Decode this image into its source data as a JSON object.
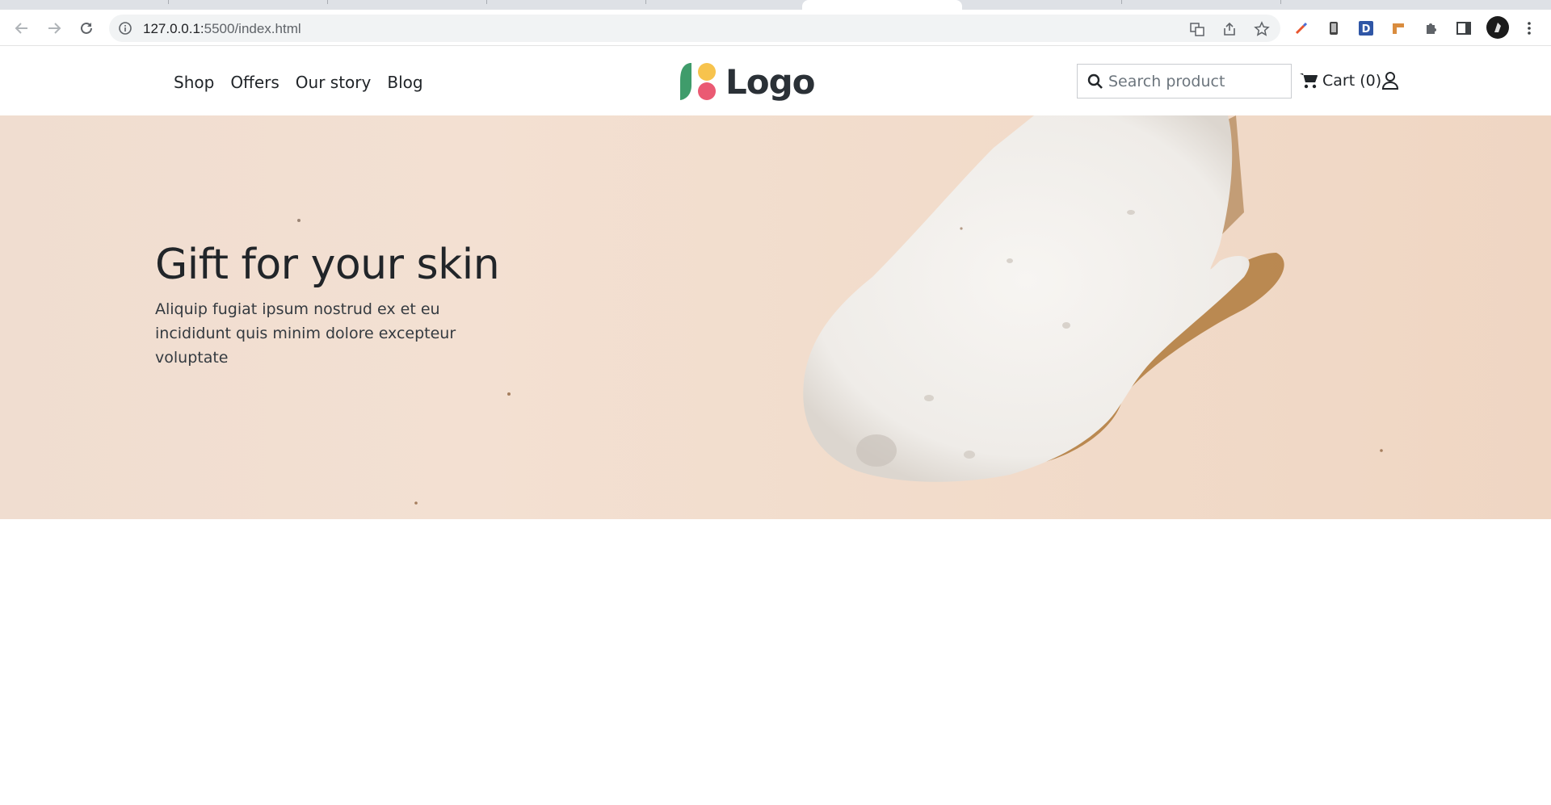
{
  "browser": {
    "url_host": "127.0.0.1:",
    "url_rest": "5500/index.html"
  },
  "nav": {
    "items": [
      "Shop",
      "Offers",
      "Our story",
      "Blog"
    ]
  },
  "logo": {
    "text": "Logo"
  },
  "search": {
    "placeholder": "Search product"
  },
  "cart": {
    "label": "Cart (0)"
  },
  "hero": {
    "title": "Gift for your skin",
    "subtitle": "Aliquip fugiat ipsum nostrud ex et eu incididunt quis minim dolore excepteur voluptate"
  },
  "colors": {
    "logo_green": "#3f9c6b",
    "logo_yellow": "#f7c34d",
    "logo_pink": "#ea5a73",
    "text": "#212529"
  }
}
